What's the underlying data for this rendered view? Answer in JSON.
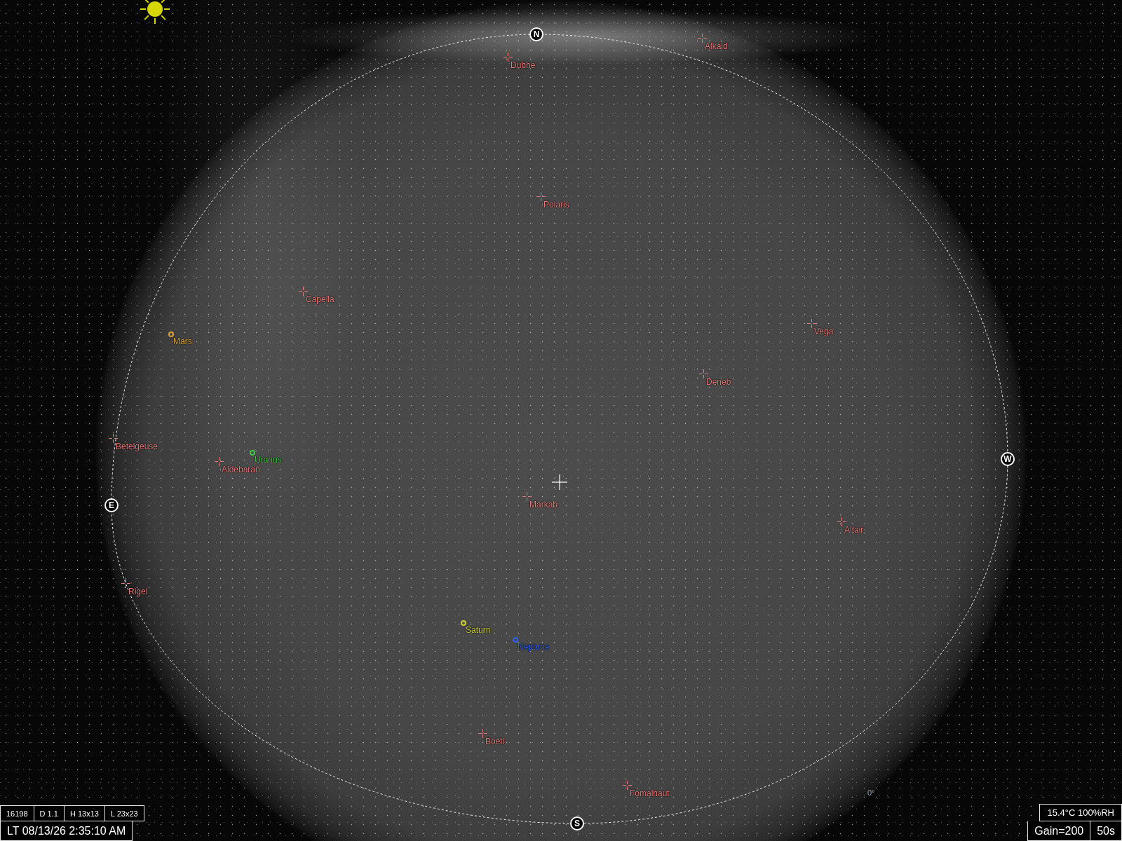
{
  "compass": [
    {
      "label": "N"
    },
    {
      "label": "W"
    },
    {
      "label": "E"
    },
    {
      "label": "S"
    }
  ],
  "objects": [
    {
      "name": "Alkaid",
      "kind": "star",
      "color": "#e87878"
    },
    {
      "name": "Dubhe",
      "kind": "star",
      "color": "#e87878"
    },
    {
      "name": "Polaris",
      "kind": "star",
      "color": "#e87878"
    },
    {
      "name": "Capella",
      "kind": "star",
      "color": "#e87878"
    },
    {
      "name": "Vega",
      "kind": "star",
      "color": "#e87878"
    },
    {
      "name": "Mars",
      "kind": "planet",
      "color": "#dba23a"
    },
    {
      "name": "Deneb",
      "kind": "star",
      "color": "#e87878"
    },
    {
      "name": "Betelgeuse",
      "kind": "star",
      "color": "#e87878"
    },
    {
      "name": "Uranus",
      "kind": "planet",
      "color": "#45c445"
    },
    {
      "name": "Aldebaran",
      "kind": "star",
      "color": "#e87878"
    },
    {
      "name": "Markab",
      "kind": "star",
      "color": "#e87878"
    },
    {
      "name": "Altair",
      "kind": "star",
      "color": "#e87878"
    },
    {
      "name": "Rigel",
      "kind": "star",
      "color": "#e87878"
    },
    {
      "name": "Saturn",
      "kind": "planet",
      "color": "#cfcf2e"
    },
    {
      "name": "Neptune",
      "kind": "planet",
      "color": "#2f62e0"
    },
    {
      "name": "Boeti",
      "kind": "star",
      "color": "#e87878"
    },
    {
      "name": "Fomalhaut",
      "kind": "star",
      "color": "#e87878"
    }
  ],
  "degree_label": "0°",
  "status_left": {
    "readouts": [
      "16198",
      "D 1.1",
      "H 13x13",
      "L 23x23"
    ],
    "timestamp": "LT 08/13/26 2:35:10 AM"
  },
  "status_right": {
    "sensor": "15.4°C 100%RH",
    "gain": "Gain=200",
    "exposure": "50s"
  }
}
